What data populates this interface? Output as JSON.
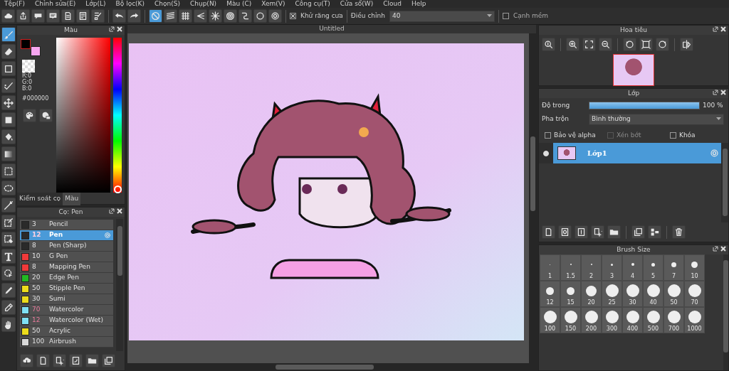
{
  "menu": [
    "Tệp(F)",
    "Chỉnh sửa(E)",
    "Lớp(L)",
    "Bộ lọc(K)",
    "Chọn(S)",
    "Chụp(N)",
    "Màu (C)",
    "Xem(V)",
    "Công cụ(T)",
    "Cửa sổ(W)",
    "Cloud",
    "Help"
  ],
  "snaps": [
    {
      "kind": "off",
      "selected": true
    },
    {
      "kind": "parallel",
      "selected": false
    },
    {
      "kind": "grid",
      "selected": false
    },
    {
      "kind": "perspective",
      "selected": false
    },
    {
      "kind": "radial",
      "selected": false
    },
    {
      "kind": "concentric",
      "selected": false
    },
    {
      "kind": "curve",
      "selected": false
    },
    {
      "kind": "circle",
      "selected": false
    },
    {
      "kind": "settings",
      "selected": false
    }
  ],
  "toolbar": {
    "antialias": {
      "label": "Khử răng cưa",
      "checked": true
    },
    "adjust": {
      "label": "Điều chỉnh",
      "value": "40"
    },
    "soft_edge": {
      "label": "Cạnh mềm",
      "checked": false
    }
  },
  "tools": [
    {
      "kind": "brush",
      "selected": true
    },
    {
      "kind": "eraser",
      "selected": false
    },
    {
      "kind": "shape",
      "selected": false
    },
    {
      "kind": "dot",
      "selected": false
    },
    {
      "kind": "move",
      "selected": false
    },
    {
      "kind": "fill",
      "selected": false
    },
    {
      "kind": "bucket",
      "selected": false
    },
    {
      "kind": "gradient",
      "selected": false
    },
    {
      "kind": "select",
      "selected": false
    },
    {
      "kind": "lasso",
      "selected": false
    },
    {
      "kind": "wand",
      "selected": false
    },
    {
      "kind": "selpen",
      "selected": false
    },
    {
      "kind": "selerase",
      "selected": false
    },
    {
      "kind": "text",
      "selected": false
    },
    {
      "kind": "operation",
      "selected": false
    },
    {
      "kind": "divide",
      "selected": false
    },
    {
      "kind": "dropper",
      "selected": false
    },
    {
      "kind": "hand",
      "selected": false
    }
  ],
  "color_panel": {
    "title": "Màu",
    "swatches": [
      {
        "kind": "foreground",
        "color": "#000000"
      },
      {
        "kind": "background",
        "color": "#f7a6f0"
      }
    ],
    "hue_slider": {
      "level": 0
    },
    "rgb": [
      "R:0",
      "G:0",
      "B:0"
    ],
    "hex": "#000000",
    "tabs": [
      {
        "label": "Kiểm soát cọ",
        "selected": false
      },
      {
        "label": "Màu",
        "selected": true
      }
    ]
  },
  "brush_panel": {
    "title": "Cọ: Pen",
    "brushes": [
      {
        "size": "3",
        "name": "Pencil",
        "color": "#2a2a2a",
        "modified": false,
        "selected": false
      },
      {
        "size": "12",
        "name": "Pen",
        "color": "#2a2a2a",
        "modified": true,
        "selected": true
      },
      {
        "size": "8",
        "name": "Pen (Sharp)",
        "color": "#2a2a2a",
        "modified": false,
        "selected": false
      },
      {
        "size": "10",
        "name": "G Pen",
        "color": "#f03a3a",
        "modified": false,
        "selected": false
      },
      {
        "size": "8",
        "name": "Mapping Pen",
        "color": "#f03a3a",
        "modified": false,
        "selected": false
      },
      {
        "size": "20",
        "name": "Edge Pen",
        "color": "#22b822",
        "modified": false,
        "selected": false
      },
      {
        "size": "50",
        "name": "Stipple Pen",
        "color": "#ecdc1c",
        "modified": false,
        "selected": false
      },
      {
        "size": "30",
        "name": "Sumi",
        "color": "#ecdc1c",
        "modified": false,
        "selected": false
      },
      {
        "size": "70",
        "name": "Watercolor",
        "color": "#7fe0f4",
        "modified": true,
        "selected": false
      },
      {
        "size": "12",
        "name": "Watercolor (Wet)",
        "color": "#7fe0f4",
        "modified": true,
        "selected": false
      },
      {
        "size": "50",
        "name": "Acrylic",
        "color": "#ecdc1c",
        "modified": false,
        "selected": false
      },
      {
        "size": "100",
        "name": "Airbrush",
        "color": "#d8d8d8",
        "modified": false,
        "selected": false
      }
    ]
  },
  "canvas": {
    "tab": "Untitled"
  },
  "navigator": {
    "title": "Hoa tiêu"
  },
  "layer_panel": {
    "title": "Lớp",
    "opacity": {
      "label": "Độ trong",
      "level": 1,
      "reading": "100 %"
    },
    "blend": {
      "label": "Pha trộn",
      "value": "Bình thường"
    },
    "options": [
      {
        "label": "Bảo vệ alpha",
        "checked": false,
        "disabled": false
      },
      {
        "label": "Xén bớt",
        "checked": false,
        "disabled": true
      },
      {
        "label": "Khóa",
        "checked": false,
        "disabled": false
      }
    ],
    "layers": [
      {
        "name": "Lớp1",
        "selected": true,
        "visible": true
      }
    ]
  },
  "brush_size": {
    "title": "Brush Size",
    "sizes": [
      "1",
      "1.5",
      "2",
      "3",
      "4",
      "5",
      "7",
      "10",
      "12",
      "15",
      "20",
      "25",
      "30",
      "40",
      "50",
      "70",
      "100",
      "150",
      "200",
      "300",
      "400",
      "500",
      "700",
      "1000"
    ]
  }
}
